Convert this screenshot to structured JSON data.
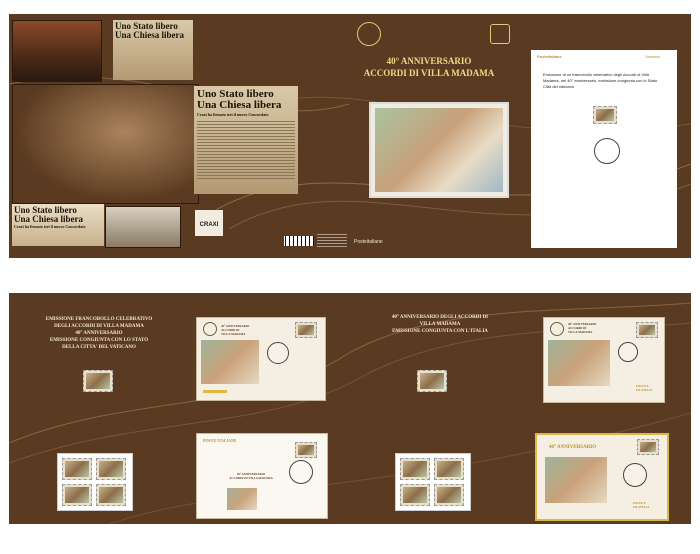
{
  "top_panel": {
    "headline_1a": "Uno Stato libero",
    "headline_1b": "Una Chiesa libera",
    "headline_2a": "Uno Stato libero",
    "headline_2b": "Una Chiesa libera",
    "headline_2c": "Craxi ha firmato ieri il nuovo Concordato",
    "headline_3a": "Uno Stato libero",
    "headline_3b": "Una Chiesa libera",
    "headline_3c": "Craxi ha firmato ieri il nuovo Concordato",
    "foundation": "CRAXI",
    "title_line1": "40° ANNIVERSARIO",
    "title_line2": "ACCORDI DI VILLA MADAMA",
    "brand": "Posteitaliane",
    "card_header_left": "Posteitaliane",
    "card_header_right": "Vaticano",
    "card_text": "Emissione di un francobollo celebrativo degli Accordi di Villa Madama, nel 40° anniversario, emissione congiunta con lo Stato Città del Vaticano"
  },
  "bottom_panel": {
    "left_block": [
      "EMISSIONE FRANCOBOLLO CELEBRATIVO",
      "DEGLI ACCORDI DI VILLA MADAMA",
      "40° ANNIVERSARIO",
      "EMISSIONE CONGIUNTA CON LO STATO",
      "DELLA CITTA' DEL VATICANO"
    ],
    "right_block": [
      "40° ANNIVERSARIO DEGLI ACCORDI DI",
      "VILLA MADAMA",
      "EMISSIONE CONGIUNTA CON L'ITALIA"
    ],
    "cover1_title": [
      "40° ANNIVERSARIO",
      "ACCORDI DI",
      "VILLA MADAMA"
    ],
    "cover2_header": "POSTE ITALIANE",
    "cover2_title": [
      "40° ANNIVERSARIO",
      "ACCORDI DI VILLA MADAMA"
    ],
    "cover3_title": [
      "40° ANNIVERSARIO",
      "ACCORDI DI",
      "VILLA MADAMA"
    ],
    "cover3_logo": [
      "POSTE E",
      "FILATELIA"
    ],
    "cover4_title": "40° ANNIVERSARIO",
    "cover4_logo": [
      "POSTE E",
      "FILATELIA"
    ]
  },
  "colors": {
    "panel_brown": "#5a3a20",
    "gold": "#f0d98a"
  }
}
